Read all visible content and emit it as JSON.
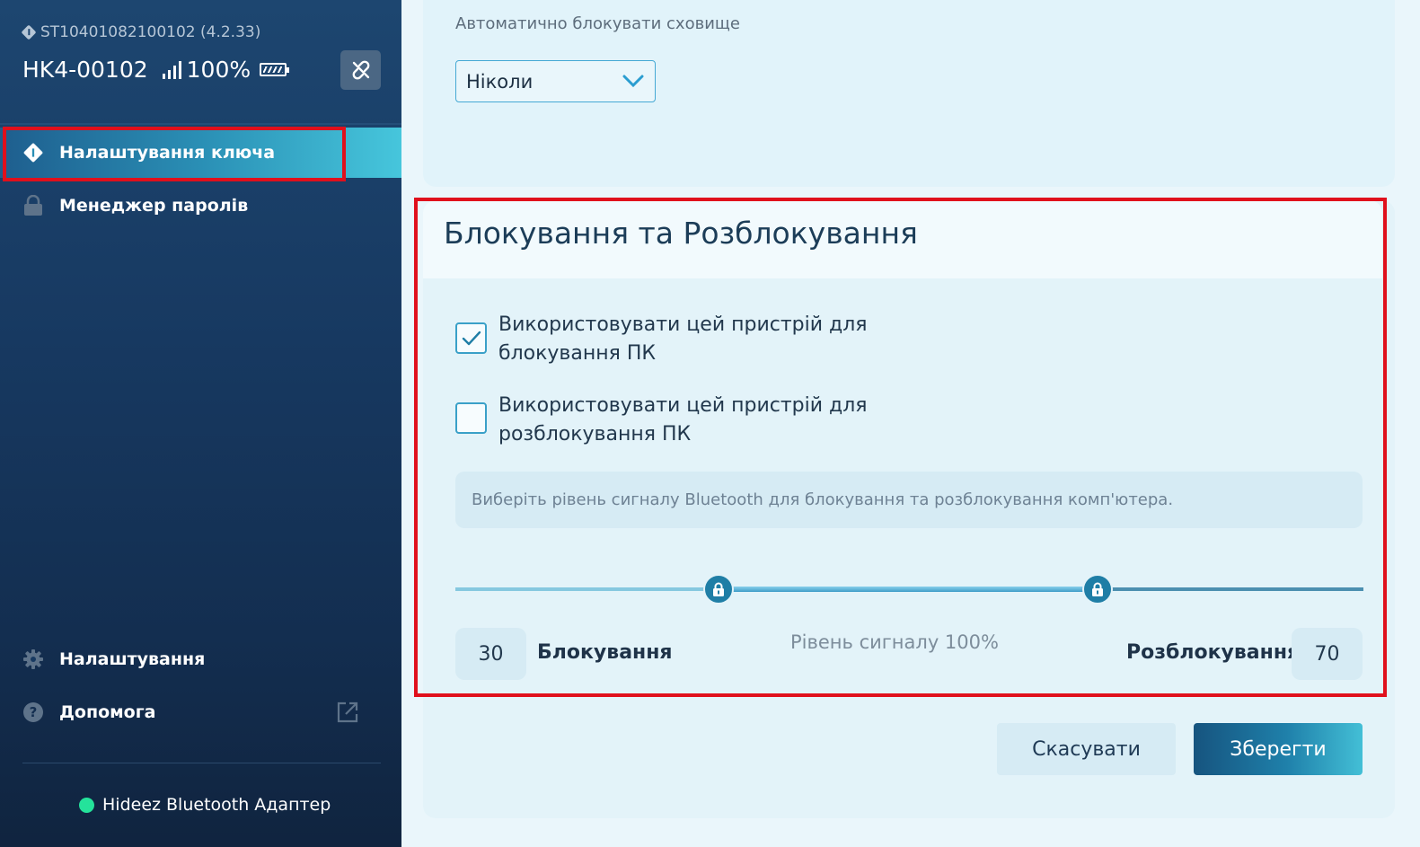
{
  "device": {
    "serial": "ST10401082100102 (4.2.33)",
    "name": "HK4-00102",
    "signal_percent": "100%"
  },
  "sidebar": {
    "items": [
      {
        "label": "Налаштування ключа",
        "icon": "key-diamond-icon",
        "active": true
      },
      {
        "label": "Менеджер паролів",
        "icon": "lock-icon",
        "active": false
      }
    ],
    "bottom_items": [
      {
        "label": "Налаштування",
        "icon": "gear-icon"
      },
      {
        "label": "Допомога",
        "icon": "help-icon"
      }
    ],
    "adapter_status": "Hideez Bluetooth Адаптер",
    "adapter_color": "#24e39b"
  },
  "autolock": {
    "label": "Автоматично блокувати сховище",
    "selected": "Ніколи"
  },
  "lock_section": {
    "title": "Блокування та Розблокування",
    "lock_checkbox": {
      "label": "Використовувати цей пристрій для блокування ПК",
      "checked": true
    },
    "unlock_checkbox": {
      "label": "Використовувати цей пристрій для розблокування ПК",
      "checked": false
    },
    "info": "Виберіть рівень сигналу Bluetooth для блокування та розблокування комп'ютера.",
    "slider": {
      "lock_value": "30",
      "lock_label": "Блокування",
      "unlock_value": "70",
      "unlock_label": "Розблокування",
      "signal_level": "Рівень сигналу 100%"
    }
  },
  "actions": {
    "cancel": "Скасувати",
    "save": "Зберегти"
  },
  "colors": {
    "accent": "#1f7ea6",
    "highlight": "#e0101c"
  }
}
